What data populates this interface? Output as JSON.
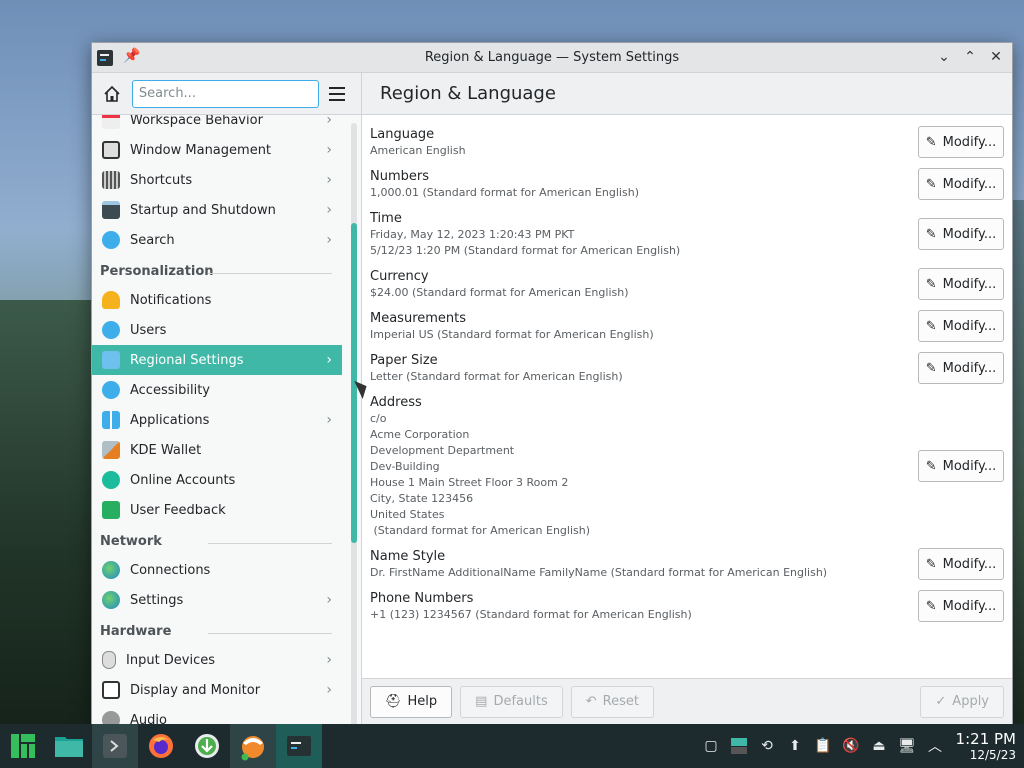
{
  "window": {
    "title": "Region & Language — System Settings"
  },
  "sidebar": {
    "search_placeholder": "Search...",
    "items": [
      {
        "label": "Workspace Behavior",
        "icon": "workspace-icon",
        "chevron": true
      },
      {
        "label": "Window Management",
        "icon": "window-icon",
        "chevron": true
      },
      {
        "label": "Shortcuts",
        "icon": "keyboard-icon",
        "chevron": true
      },
      {
        "label": "Startup and Shutdown",
        "icon": "startup-icon",
        "chevron": true
      },
      {
        "label": "Search",
        "icon": "search-icon",
        "chevron": true
      }
    ],
    "sections": {
      "personalization": "Personalization",
      "network": "Network",
      "hardware": "Hardware"
    },
    "personalization_items": [
      {
        "label": "Notifications",
        "icon": "bell-icon",
        "chevron": false
      },
      {
        "label": "Users",
        "icon": "users-icon",
        "chevron": false
      },
      {
        "label": "Regional Settings",
        "icon": "regional-icon",
        "chevron": true,
        "active": true
      },
      {
        "label": "Accessibility",
        "icon": "accessibility-icon",
        "chevron": false
      },
      {
        "label": "Applications",
        "icon": "applications-icon",
        "chevron": true
      },
      {
        "label": "KDE Wallet",
        "icon": "wallet-icon",
        "chevron": false
      },
      {
        "label": "Online Accounts",
        "icon": "online-accounts-icon",
        "chevron": false
      },
      {
        "label": "User Feedback",
        "icon": "feedback-icon",
        "chevron": false
      }
    ],
    "network_items": [
      {
        "label": "Connections",
        "icon": "globe-icon",
        "chevron": false
      },
      {
        "label": "Settings",
        "icon": "globe-icon",
        "chevron": true
      }
    ],
    "hardware_items": [
      {
        "label": "Input Devices",
        "icon": "mouse-icon",
        "chevron": true
      },
      {
        "label": "Display and Monitor",
        "icon": "monitor-icon",
        "chevron": true
      },
      {
        "label": "Audio",
        "icon": "audio-icon",
        "chevron": false
      }
    ]
  },
  "main": {
    "title": "Region & Language",
    "modify_label": "Modify...",
    "rows": [
      {
        "name": "Language",
        "lines": [
          "American English"
        ]
      },
      {
        "name": "Numbers",
        "lines": [
          "1,000.01 (Standard format for American English)"
        ]
      },
      {
        "name": "Time",
        "lines": [
          "Friday, May 12, 2023 1:20:43 PM PKT",
          "5/12/23 1:20 PM (Standard format for American English)"
        ]
      },
      {
        "name": "Currency",
        "lines": [
          "$24.00 (Standard format for American English)"
        ]
      },
      {
        "name": "Measurements",
        "lines": [
          "Imperial US (Standard format for American English)"
        ]
      },
      {
        "name": "Paper Size",
        "lines": [
          "Letter (Standard format for American English)"
        ]
      },
      {
        "name": "Address",
        "lines": [
          "c/o",
          "Acme Corporation",
          "Development Department",
          "Dev-Building",
          "House 1 Main Street Floor 3 Room 2",
          "City, State 123456",
          "United States",
          " (Standard format for American English)"
        ]
      },
      {
        "name": "Name Style",
        "lines": [
          "Dr. FirstName AdditionalName FamilyName (Standard format for American English)"
        ]
      },
      {
        "name": "Phone Numbers",
        "lines": [
          "+1 (123) 1234567 (Standard format for American English)"
        ]
      }
    ]
  },
  "footer": {
    "help": "Help",
    "defaults": "Defaults",
    "reset": "Reset",
    "apply": "Apply"
  },
  "taskbar": {
    "time": "1:21 PM",
    "date": "12/5/23"
  },
  "colors": {
    "accent": "#3fb8a8",
    "focus": "#3daee9"
  }
}
